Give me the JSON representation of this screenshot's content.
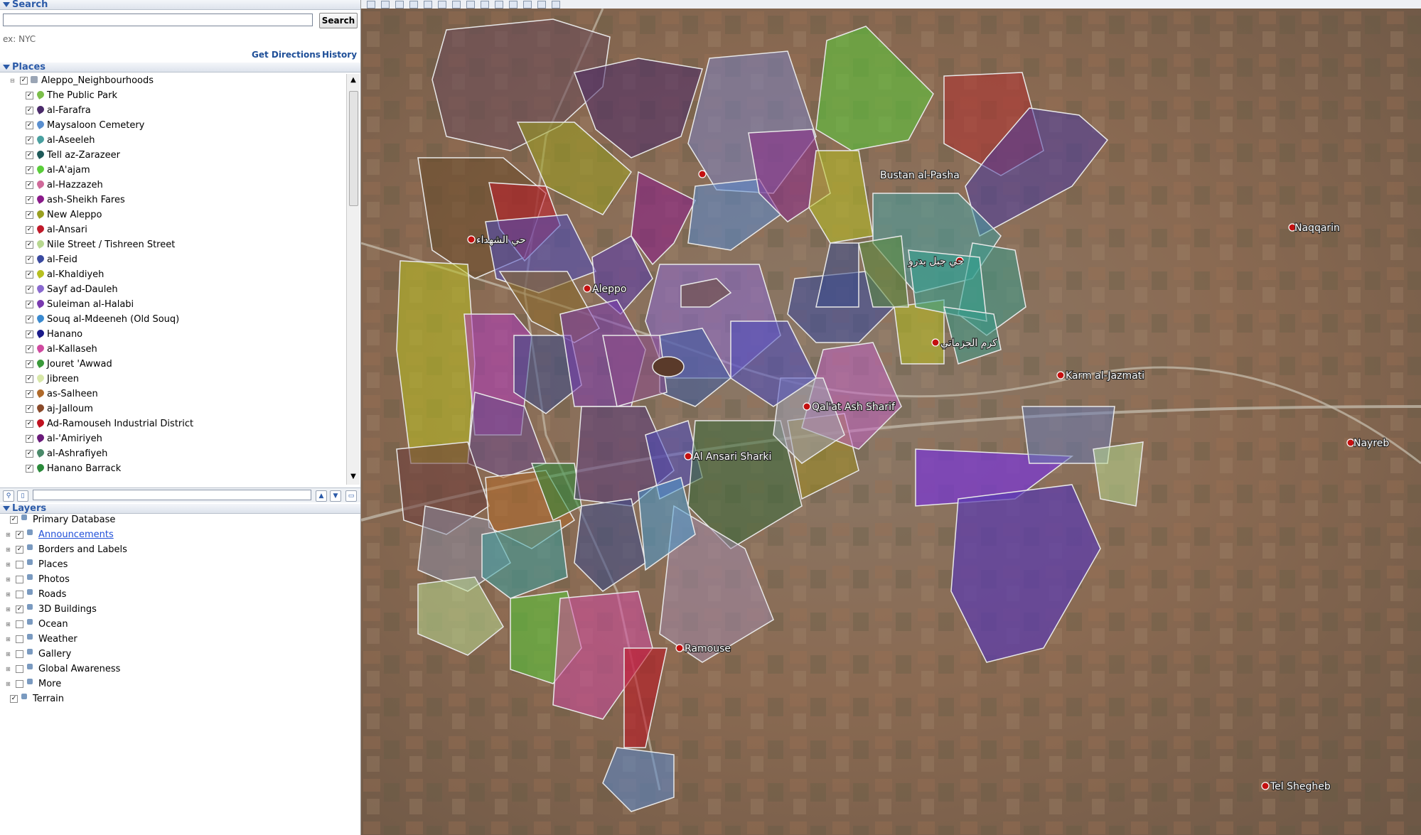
{
  "search": {
    "title": "Search",
    "input_value": "",
    "button_label": "Search",
    "hint": "ex: NYC",
    "get_directions": "Get Directions",
    "history": "History"
  },
  "places_panel": {
    "title": "Places",
    "folder": "Aleppo_Neighbourhoods",
    "items": [
      {
        "label": "The Public Park",
        "color": "#7cbf4a"
      },
      {
        "label": "al-Farafra",
        "color": "#4a2a6a"
      },
      {
        "label": "Maysaloon Cemetery",
        "color": "#5a8fd0"
      },
      {
        "label": "al-Aseeleh",
        "color": "#49a0a0"
      },
      {
        "label": "Tell az-Zarazeer",
        "color": "#1f5a5a"
      },
      {
        "label": "al-A'ajam",
        "color": "#5acd3a"
      },
      {
        "label": "al-Hazzazeh",
        "color": "#d06a9a"
      },
      {
        "label": "ash-Sheikh Fares",
        "color": "#8a1a8a"
      },
      {
        "label": "New Aleppo",
        "color": "#9aa020"
      },
      {
        "label": "al-Ansari",
        "color": "#c01a2a"
      },
      {
        "label": "Nile Street / Tishreen Street",
        "color": "#b8d890"
      },
      {
        "label": "al-Feid",
        "color": "#3a4aa0"
      },
      {
        "label": "al-Khaldiyeh",
        "color": "#b8c020"
      },
      {
        "label": "Sayf ad-Dauleh",
        "color": "#8a6ad0"
      },
      {
        "label": "Suleiman al-Halabi",
        "color": "#7a3ab0"
      },
      {
        "label": "Souq al-Mdeeneh (Old Souq)",
        "color": "#3a8ad0"
      },
      {
        "label": "Hanano",
        "color": "#1a1a8a"
      },
      {
        "label": "al-Kallaseh",
        "color": "#d04aa0"
      },
      {
        "label": "Jouret 'Awwad",
        "color": "#3a9a3a"
      },
      {
        "label": "Jibreen",
        "color": "#d8e8a8"
      },
      {
        "label": "as-Salheen",
        "color": "#b06a2a"
      },
      {
        "label": "aj-Jalloum",
        "color": "#8a4a2a"
      },
      {
        "label": "Ad-Ramouseh Industrial District",
        "color": "#c01020"
      },
      {
        "label": "al-'Amiriyeh",
        "color": "#6a1a7a"
      },
      {
        "label": "al-Ashrafiyeh",
        "color": "#4a8a6a"
      },
      {
        "label": "Hanano Barrack",
        "color": "#2a8a3a"
      }
    ]
  },
  "layers_panel": {
    "title": "Layers",
    "items": [
      {
        "label": "Primary Database",
        "checked": true
      },
      {
        "label": "Announcements",
        "checked": true,
        "link": true
      },
      {
        "label": "Borders and Labels",
        "checked": true
      },
      {
        "label": "Places",
        "checked": false
      },
      {
        "label": "Photos",
        "checked": false
      },
      {
        "label": "Roads",
        "checked": false
      },
      {
        "label": "3D Buildings",
        "checked": true
      },
      {
        "label": "Ocean",
        "checked": false
      },
      {
        "label": "Weather",
        "checked": false
      },
      {
        "label": "Gallery",
        "checked": false
      },
      {
        "label": "Global Awareness",
        "checked": false
      },
      {
        "label": "More",
        "checked": false
      },
      {
        "label": "Terrain",
        "checked": true
      }
    ]
  },
  "map": {
    "labels": [
      "Bustan al-Pasha",
      "Naqqarin",
      "حي الشهداء",
      "حي جبل بدرو",
      "Aleppo",
      "كرم الجزماتي",
      "Karm al-Jazmati",
      "Qal'at Ash Sharif",
      "Al Ansari Sharki",
      "Nayreb",
      "Ramouse",
      "Tel Shegheb"
    ]
  }
}
